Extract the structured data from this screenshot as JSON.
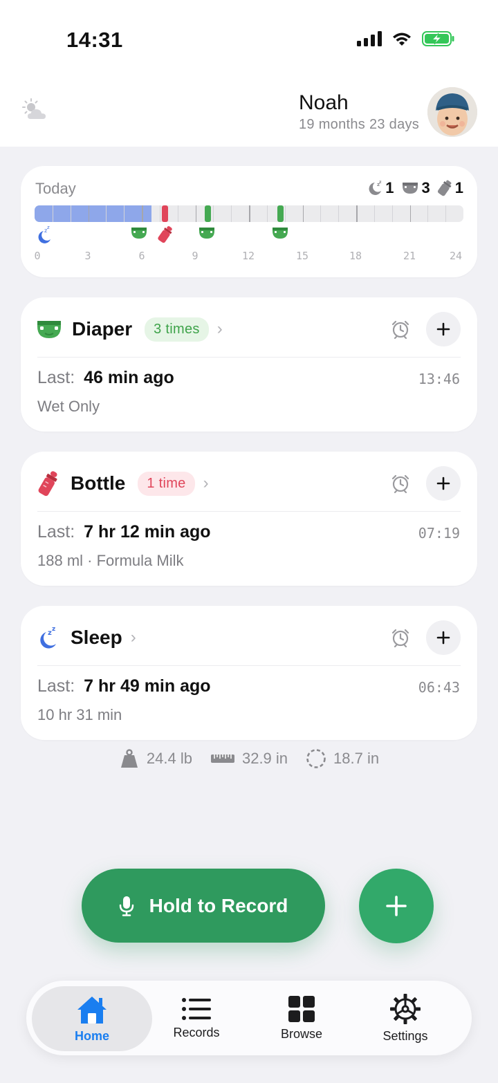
{
  "status_bar": {
    "time": "14:31"
  },
  "profile": {
    "name": "Noah",
    "age": "19 months 23 days"
  },
  "today": {
    "title": "Today",
    "counts": {
      "sleep": "1",
      "diaper": "3",
      "bottle": "1"
    },
    "axis_labels": [
      "0",
      "3",
      "6",
      "9",
      "12",
      "15",
      "18",
      "21",
      "24"
    ]
  },
  "activities": {
    "diaper": {
      "title": "Diaper",
      "badge": "3 times",
      "last_label": "Last:",
      "last_value": "46 min  ago",
      "time": "13:46",
      "detail": "Wet Only"
    },
    "bottle": {
      "title": "Bottle",
      "badge": "1 time",
      "last_label": "Last:",
      "last_value": "7 hr 12 min  ago",
      "time": "07:19",
      "detail": "188 ml · Formula Milk"
    },
    "sleep": {
      "title": "Sleep",
      "last_label": "Last:",
      "last_value": "7 hr 49 min  ago",
      "time": "06:43",
      "detail": "10 hr 31 min"
    }
  },
  "metrics": {
    "weight": "24.4 lb",
    "height": "32.9 in",
    "head": "18.7 in"
  },
  "record_button": {
    "label": "Hold to Record"
  },
  "tabs": {
    "home": "Home",
    "records": "Records",
    "browse": "Browse",
    "settings": "Settings"
  },
  "colors": {
    "accent_green": "#2f9a5e",
    "diaper_green": "#45a952",
    "bottle_red": "#e0455a",
    "sleep_blue": "#8ea7ea",
    "tab_active_blue": "#1a7ef0"
  }
}
